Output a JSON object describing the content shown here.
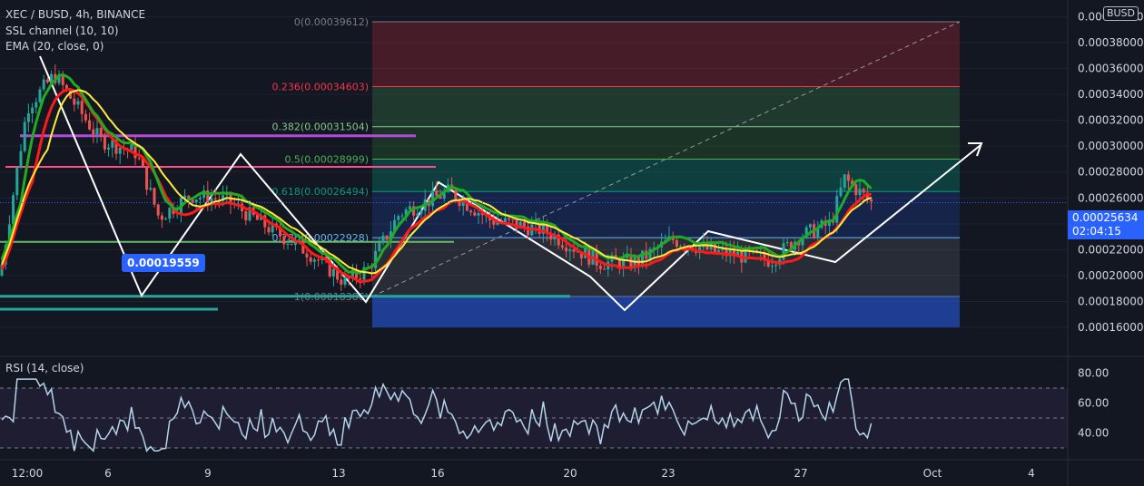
{
  "header": {
    "symbol_line": "XEC / BUSD, 4h, BINANCE",
    "indicator_1": "SSL channel (10, 10)",
    "indicator_2": "EMA (20, close, 0)",
    "rsi_label": "RSI (14, close)"
  },
  "currency_badge": "BUSD",
  "last_price": {
    "value": "0.00025634",
    "countdown": "02:04:15"
  },
  "callout_label": "0.00019559",
  "colors": {
    "background": "#131722",
    "bull": "#26a69a",
    "bear": "#ef5350",
    "ssl_green": "#22ab22",
    "ssl_red": "#ff1a1a",
    "ema": "#ffeb3b",
    "rsi": "#b3d4ea",
    "accent": "#2962ff"
  },
  "chart_data": {
    "type": "candlestick",
    "price_axis": {
      "ticks": [
        "0.00040000",
        "0.00038000",
        "0.00036000",
        "0.00034000",
        "0.00032000",
        "0.00030000",
        "0.00028000",
        "0.00026000",
        "0.00024000",
        "0.00022000",
        "0.00020000",
        "0.00018000",
        "0.00016000"
      ],
      "range": [
        0.00016,
        0.0004
      ]
    },
    "time_axis": {
      "ticks": [
        "12:00",
        "6",
        "9",
        "13",
        "16",
        "20",
        "23",
        "27",
        "Oct",
        "4"
      ]
    },
    "fibonacci": [
      {
        "label": "0(0.00039612)",
        "price": 0.00039612,
        "line": "#787b86",
        "fill": "rgba(178,40,51,0.32)"
      },
      {
        "label": "0.236(0.00034603)",
        "price": 0.00034603,
        "line": "#f23645",
        "fill": "rgba(56,120,70,0.35)"
      },
      {
        "label": "0.382(0.00031504)",
        "price": 0.00031504,
        "line": "#81c784",
        "fill": "rgba(46,125,50,0.28)"
      },
      {
        "label": "0.5(0.00028999)",
        "price": 0.00028999,
        "line": "#4caf50",
        "fill": "rgba(8,153,129,0.30)"
      },
      {
        "label": "0.618(0.00026494)",
        "price": 0.00026494,
        "line": "#089981",
        "fill": "rgba(41,98,255,0.18)"
      },
      {
        "label": "0.786(0.00022928)",
        "price": 0.00022928,
        "line": "#64b5f6",
        "fill": "rgba(120,123,134,0.22)"
      },
      {
        "label": "1(0.00018386)",
        "price": 0.00018386,
        "line": "#787b86",
        "fill": "rgba(41,98,255,0.30)"
      }
    ],
    "rsi_axis": {
      "ticks": [
        "80.00",
        "60.00",
        "40.00"
      ],
      "bands": [
        70,
        50,
        30
      ]
    }
  }
}
